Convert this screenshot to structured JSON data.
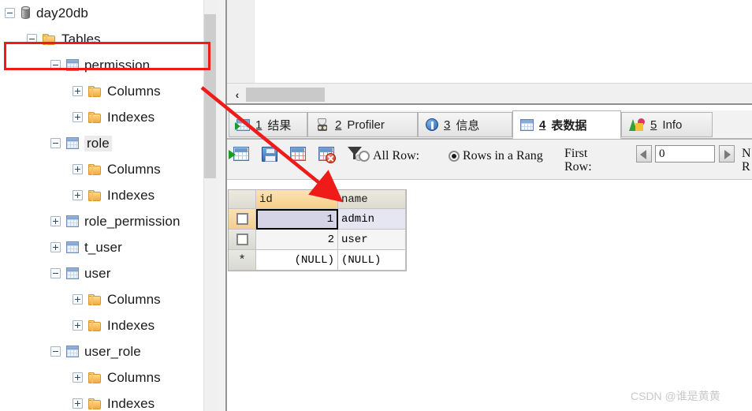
{
  "sidebar": {
    "nodes": [
      {
        "label": "day20db",
        "icon": "database-icon",
        "indent": 0,
        "toggle": "minus",
        "expanded": true,
        "selected": false
      },
      {
        "label": "Tables",
        "icon": "folder-icon",
        "indent": 1,
        "toggle": "minus",
        "expanded": true,
        "selected": false
      },
      {
        "label": "permission",
        "icon": "table-icon",
        "indent": 2,
        "toggle": "minus",
        "expanded": true,
        "selected": false
      },
      {
        "label": "Columns",
        "icon": "folder-icon",
        "indent": 3,
        "toggle": "plus",
        "expanded": false,
        "selected": false
      },
      {
        "label": "Indexes",
        "icon": "folder-icon",
        "indent": 3,
        "toggle": "plus",
        "expanded": false,
        "selected": false
      },
      {
        "label": "role",
        "icon": "table-icon",
        "indent": 2,
        "toggle": "minus",
        "expanded": true,
        "selected": true
      },
      {
        "label": "Columns",
        "icon": "folder-icon",
        "indent": 3,
        "toggle": "plus",
        "expanded": false,
        "selected": false
      },
      {
        "label": "Indexes",
        "icon": "folder-icon",
        "indent": 3,
        "toggle": "plus",
        "expanded": false,
        "selected": false
      },
      {
        "label": "role_permission",
        "icon": "table-icon",
        "indent": 2,
        "toggle": "plus",
        "expanded": false,
        "selected": false
      },
      {
        "label": "t_user",
        "icon": "table-icon",
        "indent": 2,
        "toggle": "plus",
        "expanded": false,
        "selected": false
      },
      {
        "label": "user",
        "icon": "table-icon",
        "indent": 2,
        "toggle": "minus",
        "expanded": true,
        "selected": false
      },
      {
        "label": "Columns",
        "icon": "folder-icon",
        "indent": 3,
        "toggle": "plus",
        "expanded": false,
        "selected": false
      },
      {
        "label": "Indexes",
        "icon": "folder-icon",
        "indent": 3,
        "toggle": "plus",
        "expanded": false,
        "selected": false
      },
      {
        "label": "user_role",
        "icon": "table-icon",
        "indent": 2,
        "toggle": "minus",
        "expanded": true,
        "selected": false
      },
      {
        "label": "Columns",
        "icon": "folder-icon",
        "indent": 3,
        "toggle": "plus",
        "expanded": false,
        "selected": false
      },
      {
        "label": "Indexes",
        "icon": "folder-icon",
        "indent": 3,
        "toggle": "plus",
        "expanded": false,
        "selected": false
      }
    ]
  },
  "hscroll": {
    "left_arrow": "‹"
  },
  "tabs": [
    {
      "num": "1",
      "label": "结果",
      "icon": "result-grid-icon",
      "active": false
    },
    {
      "num": "2",
      "label": "Profiler",
      "icon": "profiler-icon",
      "active": false
    },
    {
      "num": "3",
      "label": "信息",
      "icon": "info-badge-icon",
      "active": false
    },
    {
      "num": "4",
      "label": "表数据",
      "icon": "table-data-icon",
      "active": true
    },
    {
      "num": "5",
      "label": "Info",
      "icon": "chart-icon",
      "active": false
    }
  ],
  "toolbar": {
    "buttons": [
      {
        "name": "add-row-button",
        "icon": "grid-add-icon"
      },
      {
        "name": "save-button",
        "icon": "floppy-icon"
      },
      {
        "name": "refresh-grid-button",
        "icon": "grid-refresh-icon"
      },
      {
        "name": "delete-row-button",
        "icon": "grid-delete-icon"
      },
      {
        "name": "filter-button",
        "icon": "funnel-icon"
      }
    ],
    "radio_all_rows": {
      "label": "All Row:",
      "selected": false
    },
    "radio_range": {
      "label": "Rows in a Rang",
      "selected": true
    },
    "first_row_label_line1": "First",
    "first_row_label_line2": "Row:",
    "first_row_value": "0",
    "left_spin_icon": "left-triangle-icon",
    "right_spin_icon": "right-triangle-icon",
    "num_rows_label_line1": "N",
    "num_rows_label_line2": "R"
  },
  "grid": {
    "columns": [
      "id",
      "name"
    ],
    "selected_column": "id",
    "rows": [
      {
        "selector": "checkbox",
        "id": "1",
        "name": "admin",
        "current": true
      },
      {
        "selector": "checkbox",
        "id": "2",
        "name": "user",
        "current": false
      },
      {
        "selector": "*",
        "id": "(NULL)",
        "name": "(NULL)",
        "current": false
      }
    ]
  },
  "watermark": "CSDN @谁是黄黄"
}
